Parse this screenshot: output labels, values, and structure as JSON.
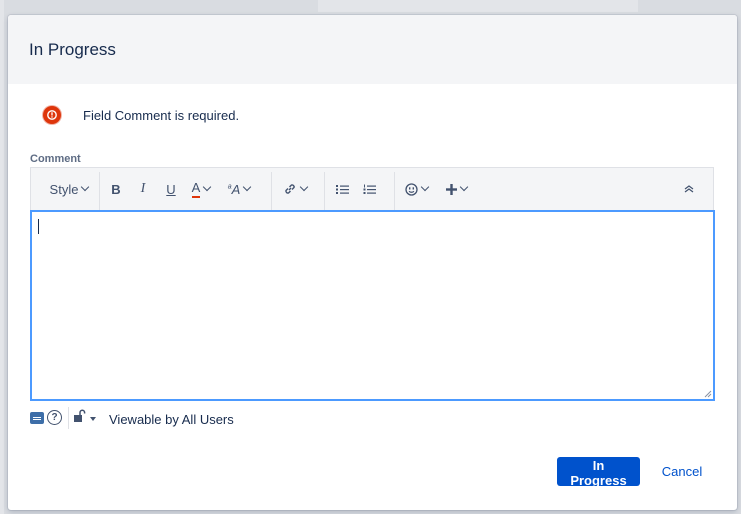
{
  "dialog": {
    "title": "In Progress",
    "error_message": "Field Comment is required.",
    "field_label": "Comment"
  },
  "toolbar": {
    "style_label": "Style",
    "bold": "B",
    "italic": "I",
    "underline": "U",
    "text_color": "A",
    "text_color_underline": "#de350b",
    "more_formatting": "A"
  },
  "footer": {
    "visibility_label": "Viewable by All Users"
  },
  "actions": {
    "submit_label": "In Progress",
    "cancel_label": "Cancel"
  },
  "colors": {
    "primary": "#0052cc",
    "focus_border": "#4c9aff",
    "error": "#de350b"
  }
}
